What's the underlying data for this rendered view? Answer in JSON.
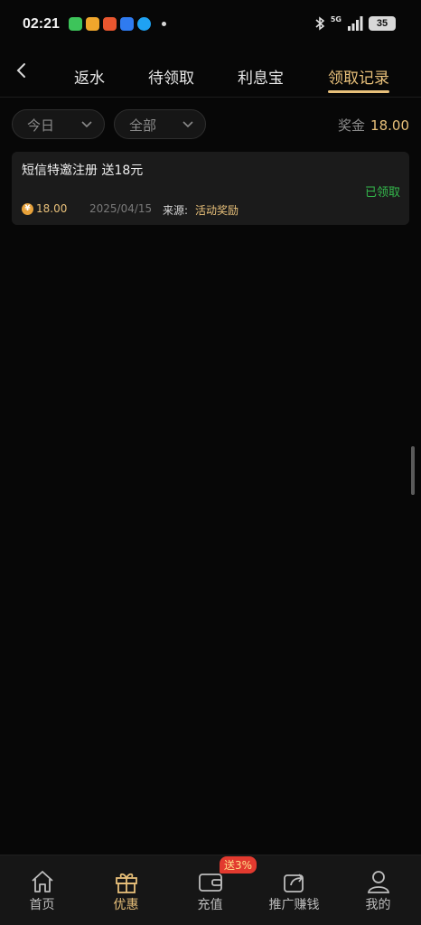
{
  "status_bar": {
    "time": "02:21",
    "network": "5G",
    "battery": "35"
  },
  "tabs": [
    {
      "label": "返水"
    },
    {
      "label": "待领取"
    },
    {
      "label": "利息宝"
    },
    {
      "label": "领取记录"
    }
  ],
  "filters": {
    "date": "今日",
    "category": "全部"
  },
  "bonus": {
    "label": "奖金",
    "value": "18.00"
  },
  "records": [
    {
      "title": "短信特邀注册 送18元",
      "status": "已领取",
      "coin_symbol": "¥",
      "amount": "18.00",
      "date": "2025/04/15",
      "source_label": "来源:",
      "source_value": "活动奖励"
    }
  ],
  "bottom_nav": {
    "items": [
      {
        "label": "首页",
        "icon": "home-icon"
      },
      {
        "label": "优惠",
        "icon": "gift-icon"
      },
      {
        "label": "充值",
        "icon": "wallet-icon"
      },
      {
        "label": "推广赚钱",
        "icon": "share-icon"
      },
      {
        "label": "我的",
        "icon": "user-icon"
      }
    ],
    "badge": "送3%"
  },
  "colors": {
    "accent": "#e8c07a",
    "success": "#34b84c",
    "background": "#070707",
    "badge": "#e23a2f"
  }
}
